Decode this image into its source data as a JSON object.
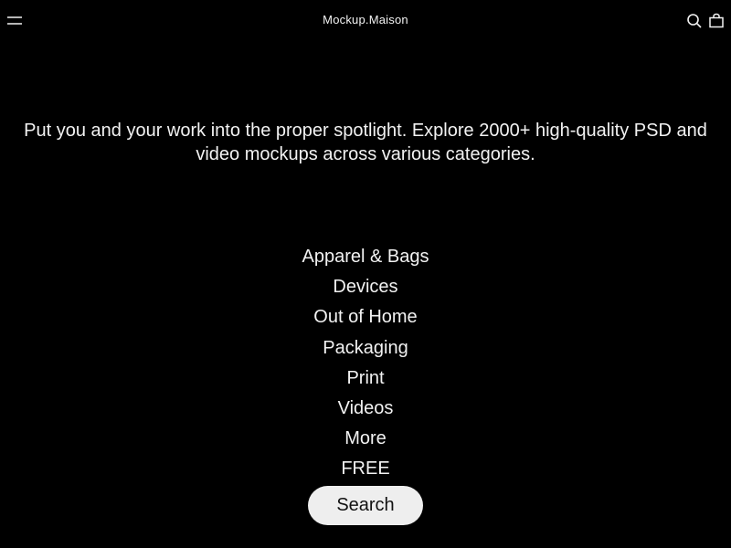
{
  "header": {
    "brand": "Mockup.Maison",
    "icons": {
      "menu": "hamburger-menu-icon",
      "search": "search-icon",
      "cart": "shopping-bag-icon"
    }
  },
  "intro": {
    "text": "Put you and your work into the proper spotlight. Explore 2000+ high-quality PSD and video mockups across various categories."
  },
  "categories": [
    {
      "label": "Apparel & Bags"
    },
    {
      "label": "Devices"
    },
    {
      "label": "Out of Home"
    },
    {
      "label": "Packaging"
    },
    {
      "label": "Print"
    },
    {
      "label": "Videos"
    },
    {
      "label": "More"
    },
    {
      "label": "FREE"
    }
  ],
  "search_button": {
    "label": "Search"
  },
  "colors": {
    "background": "#000000",
    "text": "#f2f2f2",
    "button_bg": "#eeeeee",
    "button_text": "#111111"
  }
}
